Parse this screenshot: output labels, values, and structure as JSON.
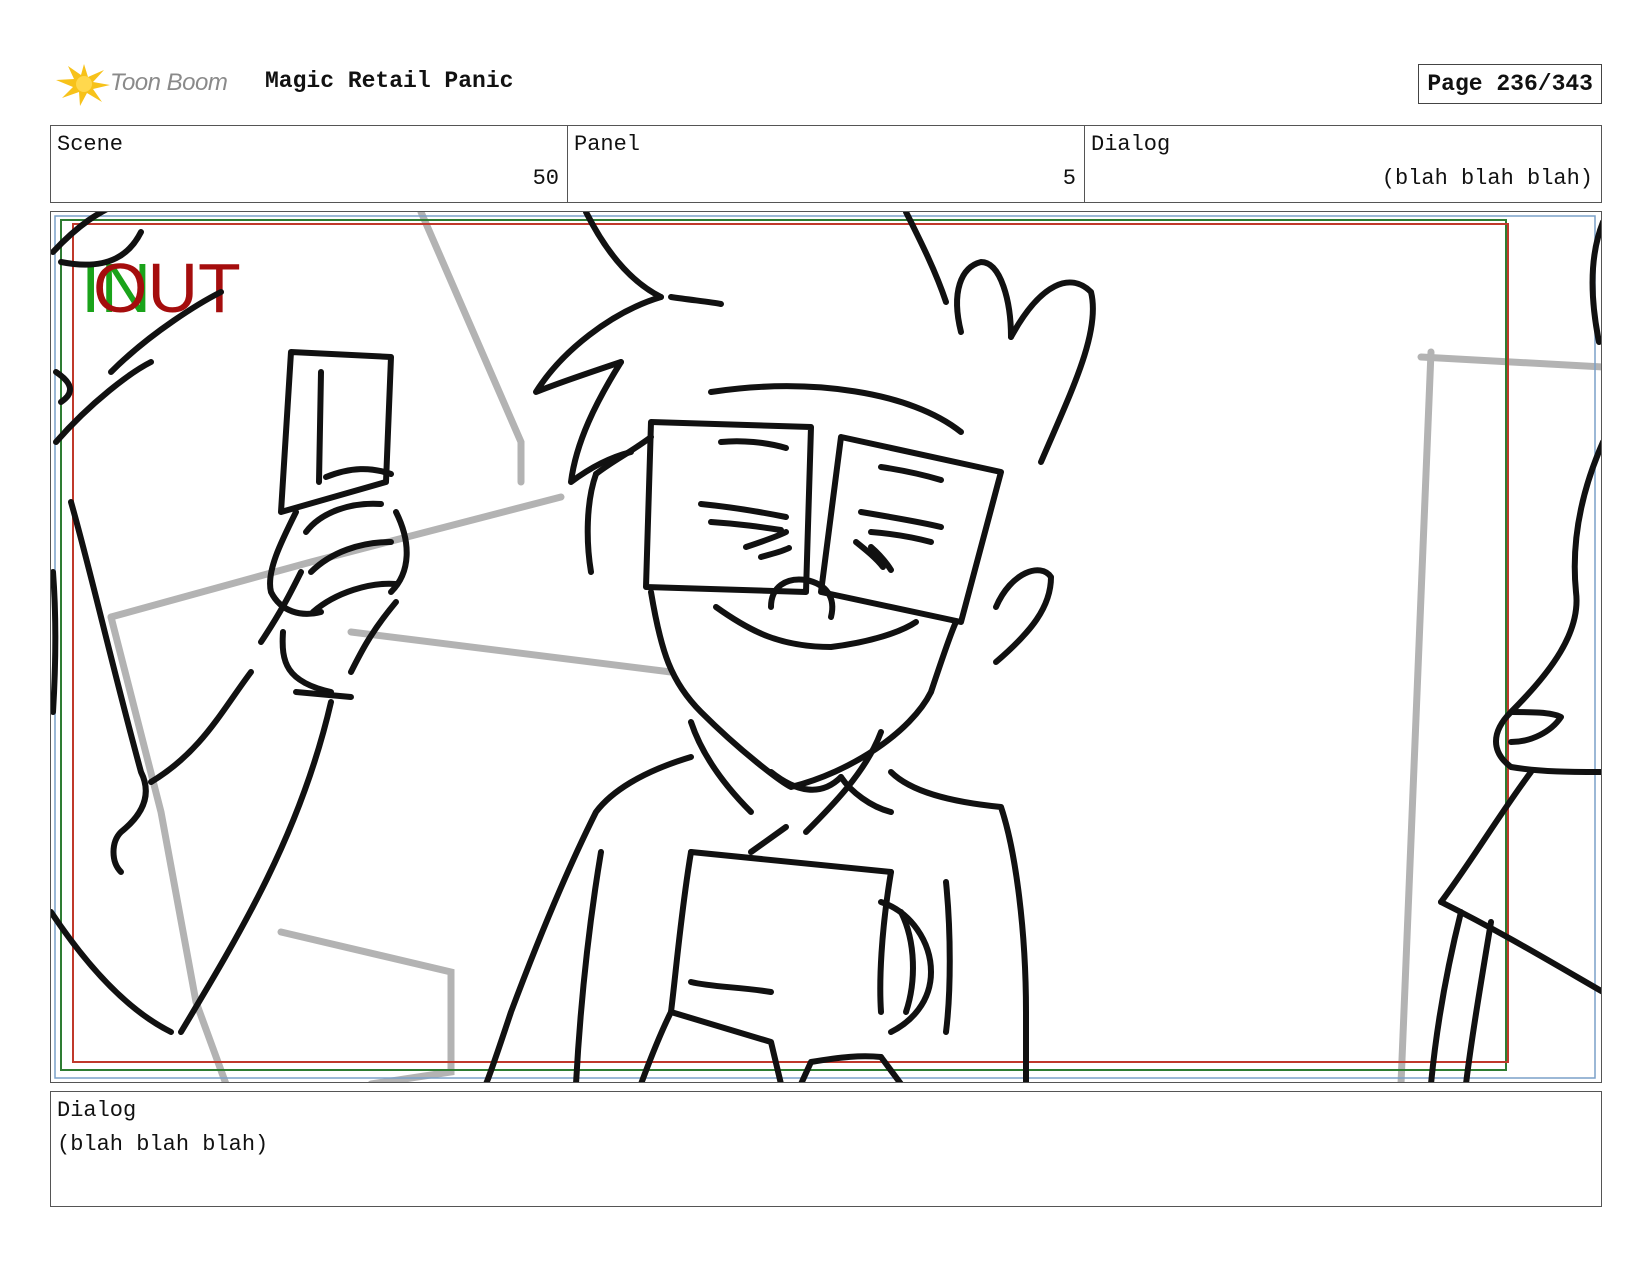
{
  "header": {
    "logo_text": "Toon Boom",
    "project_title": "Magic Retail Panic",
    "page_label": "Page 236/343"
  },
  "info": {
    "scene_label": "Scene",
    "scene_value": "50",
    "panel_label": "Panel",
    "panel_value": "5",
    "dialog_label": "Dialog",
    "dialog_value": "(blah blah blah)"
  },
  "frame": {
    "in_marker": "IN",
    "out_marker": "OUT",
    "in_color": "#1aa31a",
    "out_color": "#a50d0d",
    "safe_area_color": "#c0392b",
    "title_safe_color": "#2e7d32"
  },
  "dialog": {
    "label": "Dialog",
    "text": "(blah blah blah)"
  }
}
